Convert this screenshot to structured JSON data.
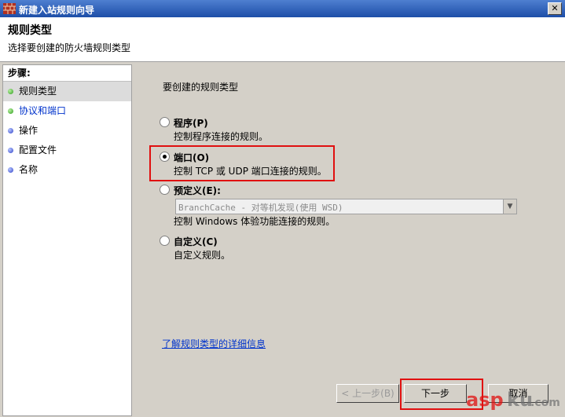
{
  "window": {
    "title": "新建入站规则向导",
    "close_glyph": "✕"
  },
  "header": {
    "heading": "规则类型",
    "subheading": "选择要创建的防火墙规则类型"
  },
  "steps": {
    "title": "步骤:",
    "items": [
      {
        "label": "规则类型",
        "state": "active"
      },
      {
        "label": "协议和端口",
        "state": "link"
      },
      {
        "label": "操作",
        "state": "normal"
      },
      {
        "label": "配置文件",
        "state": "normal"
      },
      {
        "label": "名称",
        "state": "normal"
      }
    ]
  },
  "main": {
    "prompt": "要创建的规则类型",
    "options": [
      {
        "label": "程序(P)",
        "desc": "控制程序连接的规则。",
        "checked": false
      },
      {
        "label": "端口(O)",
        "desc": "控制 TCP 或 UDP 端口连接的规则。",
        "checked": true
      },
      {
        "label": "预定义(E):",
        "desc": "控制 Windows 体验功能连接的规则。",
        "checked": false
      },
      {
        "label": "自定义(C)",
        "desc": "自定义规则。",
        "checked": false
      }
    ],
    "predefined_select": {
      "value": "BranchCache - 对等机发现(使用 WSD)"
    },
    "learn_more_link": "了解规则类型的详细信息"
  },
  "buttons": {
    "back": "< 上一步(B)",
    "next": "下一步",
    "cancel": "取消"
  },
  "colors": {
    "highlight_box": "#e01010",
    "link": "#0033cc"
  }
}
